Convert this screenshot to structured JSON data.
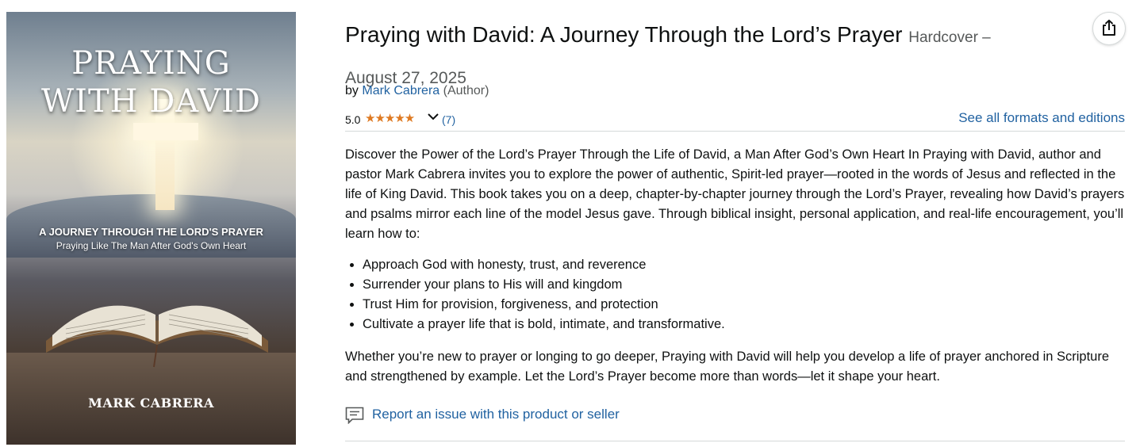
{
  "product": {
    "title": "Praying with David: A Journey Through the Lord’s Prayer",
    "binding": "Hardcover –",
    "date": "August 27, 2025",
    "by_prefix": "by",
    "author_name": "Mark Cabrera",
    "author_role": "(Author)",
    "rating_value": "5.0",
    "stars": "★★★★★",
    "stars_value": 5.0,
    "rating_count": "(7)",
    "see_formats": "See all formats and editions",
    "description": {
      "intro": "Discover the Power of the Lord’s Prayer Through the Life of David, a Man After God’s Own Heart In Praying with David, author and pastor Mark Cabrera invites you to explore the power of authentic, Spirit-led prayer—rooted in the words of Jesus and reflected in the life of King David. This book takes you on a deep, chapter-by-chapter journey through the Lord’s Prayer, revealing how David’s prayers and psalms mirror each line of the model Jesus gave. Through biblical insight, personal application, and real-life encouragement, you’ll learn how to:",
      "bullets": [
        "Approach God with honesty, trust, and reverence",
        "Surrender your plans to His will and kingdom",
        "Trust Him for provision, forgiveness, and protection",
        "Cultivate a prayer life that is bold, intimate, and transformative."
      ],
      "closing": "Whether you’re new to prayer or longing to go deeper, Praying with David will help you develop a life of prayer anchored in Scripture and strengthened by example. Let the Lord’s Prayer become more than words—let it shape your heart."
    },
    "report_label": "Report an issue with this product or seller"
  },
  "cover": {
    "title_line1": "PRAYING",
    "title_line2": "WITH DAVID",
    "subtitle1": "A JOURNEY THROUGH THE LORD'S PRAYER",
    "subtitle2": "Praying Like The Man After God's Own Heart",
    "author": "MARK CABRERA"
  },
  "icons": {
    "share": "share-icon",
    "chevron": "chevron-down-icon",
    "report": "speech-bubble-icon"
  },
  "colors": {
    "link": "#2162a1",
    "star": "#de7921",
    "muted": "#565959"
  }
}
